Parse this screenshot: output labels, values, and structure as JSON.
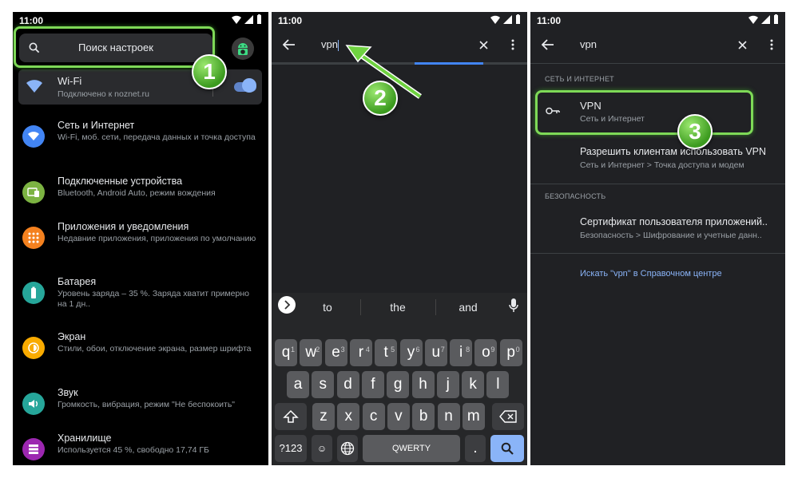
{
  "status": {
    "time": "11:00"
  },
  "panel1": {
    "search_placeholder": "Поиск настроек",
    "wifi": {
      "title": "Wi-Fi",
      "subtitle": "Подключено к noznet.ru"
    },
    "items": [
      {
        "title": "Сеть и Интернет",
        "subtitle": "Wi-Fi, моб. сети, передача данных и точка доступа",
        "icon": "wifi-icon",
        "color": "#4285f4"
      },
      {
        "title": "Подключенные устройства",
        "subtitle": "Bluetooth, Android Auto, режим вождения",
        "icon": "devices-icon",
        "color": "#7cb342"
      },
      {
        "title": "Приложения и уведомления",
        "subtitle": "Недавние приложения, приложения по умолчанию",
        "icon": "apps-icon",
        "color": "#f4811f"
      },
      {
        "title": "Батарея",
        "subtitle": "Уровень заряда – 35 %. Заряда хватит примерно на 1 дн..",
        "icon": "battery-icon",
        "color": "#26a69a"
      },
      {
        "title": "Экран",
        "subtitle": "Стили, обои, отключение экрана, размер шрифта",
        "icon": "brightness-icon",
        "color": "#f9ab00"
      },
      {
        "title": "Звук",
        "subtitle": "Громкость, вибрация, режим \"Не беспокоить\"",
        "icon": "volume-icon",
        "color": "#26a69a"
      },
      {
        "title": "Хранилище",
        "subtitle": "Используется 45 %, свободно 17,74 ГБ",
        "icon": "storage-icon",
        "color": "#9c27b0"
      }
    ]
  },
  "panel2": {
    "query": "vpn",
    "suggestions": [
      "to",
      "the",
      "and"
    ],
    "rows": [
      [
        {
          "k": "q",
          "h": "1"
        },
        {
          "k": "w",
          "h": "2"
        },
        {
          "k": "e",
          "h": "3"
        },
        {
          "k": "r",
          "h": "4"
        },
        {
          "k": "t",
          "h": "5"
        },
        {
          "k": "y",
          "h": "6"
        },
        {
          "k": "u",
          "h": "7"
        },
        {
          "k": "i",
          "h": "8"
        },
        {
          "k": "o",
          "h": "9"
        },
        {
          "k": "p",
          "h": "0"
        }
      ],
      [
        {
          "k": "a"
        },
        {
          "k": "s"
        },
        {
          "k": "d"
        },
        {
          "k": "f"
        },
        {
          "k": "g"
        },
        {
          "k": "h"
        },
        {
          "k": "j"
        },
        {
          "k": "k"
        },
        {
          "k": "l"
        }
      ],
      [
        {
          "k": "z"
        },
        {
          "k": "x"
        },
        {
          "k": "c"
        },
        {
          "k": "v"
        },
        {
          "k": "b"
        },
        {
          "k": "n"
        },
        {
          "k": "m"
        }
      ]
    ],
    "sym_label": "?123",
    "space_label": "QWERTY"
  },
  "panel3": {
    "query": "vpn",
    "section1": "СЕТЬ И ИНТЕРНЕТ",
    "results1": [
      {
        "title": "VPN",
        "subtitle": "Сеть и Интернет"
      },
      {
        "title": "Разрешить клиентам использовать VPN",
        "subtitle": "Сеть и Интернет > Точка доступа и модем"
      }
    ],
    "section2": "БЕЗОПАСНОСТЬ",
    "results2": [
      {
        "title": "Сертификат пользователя приложений..",
        "subtitle": "Безопасность > Шифрование и учетные данн.."
      }
    ],
    "help_link": "Искать \"vpn\" в Справочном центре"
  },
  "badges": [
    "1",
    "2",
    "3"
  ],
  "accent": "#8ab4f8",
  "highlight_color": "#7ed957"
}
